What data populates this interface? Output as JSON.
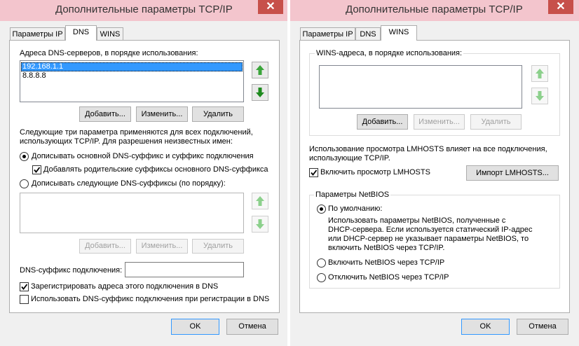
{
  "colors": {
    "titlebar": "#f3c5cd",
    "close": "#c7504a",
    "selection": "#3399ff",
    "arrow_green": "#3aa53a"
  },
  "left": {
    "title": "Дополнительные параметры TCP/IP",
    "close_label": "✕",
    "tabs": [
      {
        "label": "Параметры IP",
        "active": false
      },
      {
        "label": "DNS",
        "active": true
      },
      {
        "label": "WINS",
        "active": false
      }
    ],
    "dns_servers_label": "Адреса DNS-серверов, в порядке использования:",
    "dns_servers": [
      "192.168.1.1",
      "8.8.8.8"
    ],
    "selected_dns_server": "192.168.1.1",
    "add_label": "Добавить...",
    "edit_label": "Изменить...",
    "delete_label": "Удалить",
    "info_line1": "Следующие три параметра применяются для всех подключений,",
    "info_line2": "использующих TCP/IP. Для разрешения неизвестных имен:",
    "radio_primary": "Дописывать основной DNS-суффикс и суффикс подключения",
    "check_parent": "Добавлять родительские суффиксы основного DNS-суффикса",
    "radio_following": "Дописывать следующие DNS-суффиксы (по порядку):",
    "add2_label": "Добавить...",
    "edit2_label": "Изменить...",
    "delete2_label": "Удалить",
    "suffix_label": "DNS-суффикс подключения:",
    "suffix_value": "",
    "check_register": "Зарегистрировать адреса этого подключения в DNS",
    "check_use_suffix": "Использовать DNS-суффикс подключения при регистрации в DNS",
    "ok_label": "OK",
    "cancel_label": "Отмена"
  },
  "right": {
    "title": "Дополнительные параметры TCP/IP",
    "close_label": "✕",
    "tabs": [
      {
        "label": "Параметры IP",
        "active": false
      },
      {
        "label": "DNS",
        "active": false
      },
      {
        "label": "WINS",
        "active": true
      }
    ],
    "wins_label": "WINS-адреса, в порядке использования:",
    "add_label": "Добавить...",
    "edit_label": "Изменить...",
    "delete_label": "Удалить",
    "lmhosts_line1": "Использование просмотра LMHOSTS влияет на все подключения,",
    "lmhosts_line2": "использующие TCP/IP.",
    "check_lmhosts": "Включить просмотр LMHOSTS",
    "import_label": "Импорт LMHOSTS...",
    "netbios_group": "Параметры NetBIOS",
    "radio_default": "По умолчанию:",
    "default_desc": [
      "Использовать параметры NetBIOS, полученные с",
      "DHCP-сервера. Если используется статический IP-адрес",
      "или DHCP-сервер не указывает параметры NetBIOS, то",
      "включить NetBIOS через TCP/IP."
    ],
    "radio_enable": "Включить NetBIOS через TCP/IP",
    "radio_disable": "Отключить NetBIOS через TCP/IP",
    "ok_label": "OK",
    "cancel_label": "Отмена"
  }
}
